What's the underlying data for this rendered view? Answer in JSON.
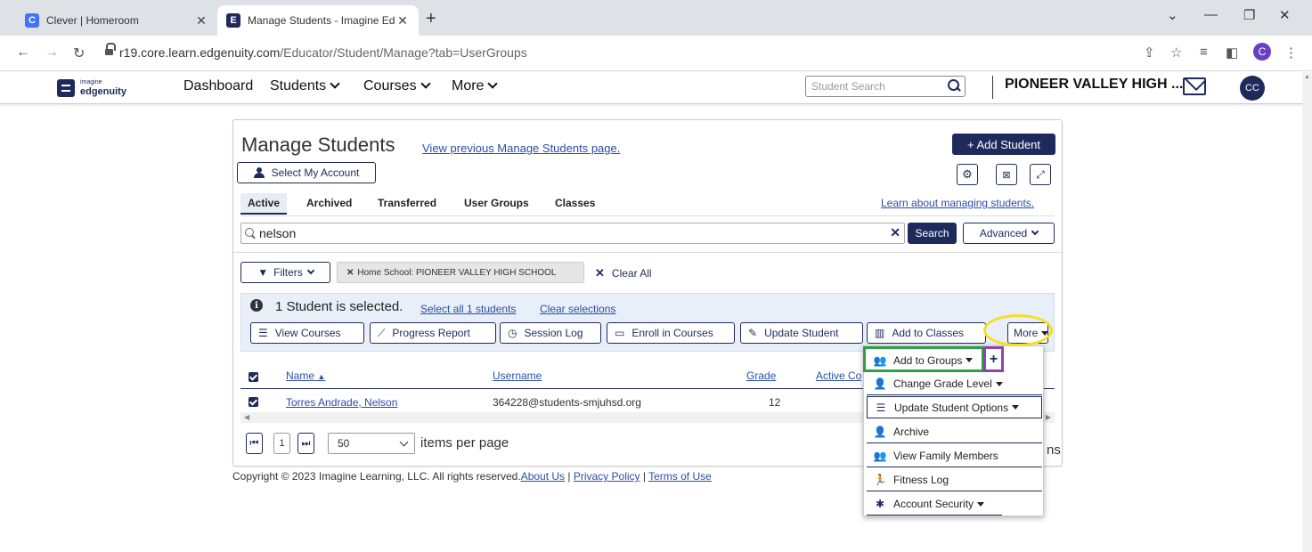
{
  "browser": {
    "tabs": [
      {
        "title": "Clever | Homeroom",
        "favicon": "C"
      },
      {
        "title": "Manage Students - Imagine Edge",
        "favicon": "E"
      }
    ],
    "url_host": "r19.core.learn.edgenuity.com",
    "url_path": "/Educator/Student/Manage?tab=UserGroups",
    "profile_initial": "C"
  },
  "header": {
    "logo_small": "imagine",
    "logo_big": "edgenuity",
    "nav": [
      "Dashboard",
      "Students",
      "Courses",
      "More"
    ],
    "search_placeholder": "Student Search",
    "school": "PIONEER VALLEY HIGH ...",
    "avatar": "CC"
  },
  "page": {
    "title": "Manage Students",
    "prev_link": "View previous Manage Students page.",
    "select_account": "Select My Account",
    "add_student": "+ Add Student",
    "tabs": [
      "Active",
      "Archived",
      "Transferred",
      "User Groups",
      "Classes"
    ],
    "learn_link": "Learn about managing students.",
    "search_value": "nelson",
    "search_button": "Search",
    "advanced_button": "Advanced",
    "filters_button": "Filters",
    "filter_chip": "Home School: PIONEER VALLEY HIGH SCHOOL",
    "clear_all": "Clear All"
  },
  "selection": {
    "text": "1 Student is selected.",
    "select_all": "Select all 1 students",
    "clear": "Clear selections",
    "actions": [
      "View Courses",
      "Progress Report",
      "Session Log",
      "Enroll in Courses",
      "Update Student",
      "Add to Classes",
      "More"
    ]
  },
  "table": {
    "columns": [
      "Name",
      "Username",
      "Grade",
      "Active Co"
    ],
    "rows": [
      {
        "name": "Torres Andrade, Nelson",
        "username": "364228@students-smjuhsd.org",
        "grade": "12"
      }
    ]
  },
  "pager": {
    "page": "1",
    "per_page": "50",
    "per_page_label": "items per page",
    "tail": "ns"
  },
  "dropdown": {
    "items": [
      "Add to Groups",
      "Change Grade Level",
      "Update Student Options",
      "Archive",
      "View Family Members",
      "Fitness Log",
      "Account Security"
    ],
    "plus": "+"
  },
  "footer": {
    "copyright": "Copyright © 2023 Imagine Learning, LLC. All rights reserved.",
    "links": [
      "About Us",
      "Privacy Policy",
      "Terms of Use"
    ]
  },
  "colors": {
    "brand_navy": "#1f2a5c",
    "link_blue": "#2a4ea6",
    "highlight_green": "#2ea043",
    "highlight_purple": "#8e44ad",
    "highlight_yellow": "#f5e020"
  }
}
